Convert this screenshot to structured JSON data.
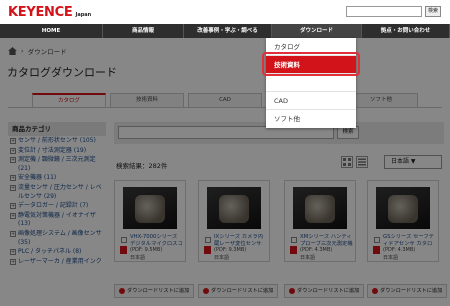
{
  "header": {
    "logo_text": "KEYENCE",
    "logo_sub": "Japan",
    "search_button": "検索",
    "search_placeholder": ""
  },
  "nav": {
    "items": [
      "HOME",
      "商品情報",
      "改善事例・学ぶ・調べる",
      "ダウンロード",
      "拠点・お問い合わせ"
    ]
  },
  "breadcrumb": {
    "current": "ダウンロード"
  },
  "page": {
    "title": "カタログダウンロード"
  },
  "tabs": [
    "カタログ",
    "技術資料",
    "CAD",
    "",
    "ソフト他"
  ],
  "dropdown": {
    "items": [
      "カタログ",
      "技術資料",
      "",
      "CAD",
      "ソフト他"
    ],
    "selected_index": 1
  },
  "sidebar": {
    "title": "商品カテゴリ",
    "items": [
      "センサ / 前形状センサ (105)",
      "変位計 / 寸法測定器 (19)",
      "測定機 / 顕微鏡 / 三次元測定 (21)",
      "安全機器 (11)",
      "流量センサ / 圧力センサ / レベルセンサ (29)",
      "データロガー / 記録計 (7)",
      "静電気対策機器 / イオナイザ (13)",
      "画像処理システム / 画像センサ (35)",
      "PLC / タッチパネル (8)",
      "レーザーマーカ / 産業用インク"
    ]
  },
  "keyword": {
    "button": "検索"
  },
  "results": {
    "count_text": "検索結果：282件"
  },
  "language_select": {
    "value": "日本語 ▼"
  },
  "cards": [
    {
      "name": "VHX-7000シリーズ デジタルマイクロスコープ カタログ",
      "size": "(PDF: 9.5MB)",
      "lang": "日本語"
    },
    {
      "name": "IXシリーズ カメラ内蔵レーザ変位センサ カタログ",
      "size": "(PDF: 9.3MB)",
      "lang": "日本語"
    },
    {
      "name": "XMシリーズ ハンディプローブ三次元測定機 カタログ",
      "size": "(PDF: 4.3MB)",
      "lang": "日本語"
    },
    {
      "name": "GSシリーズ セーフティドアセンサ カタログ",
      "size": "(PDF: 4.3MB)",
      "lang": "日本語"
    }
  ],
  "add_list_label": "ダウンロードリストに追加"
}
